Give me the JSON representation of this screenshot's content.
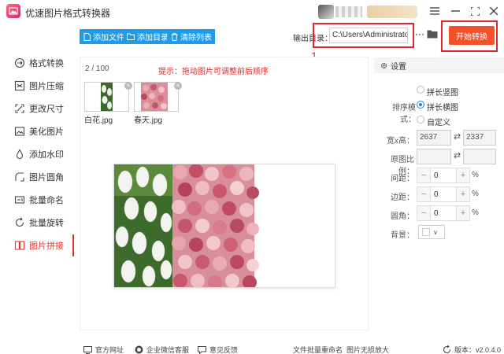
{
  "app": {
    "title": "优速图片格式转换器"
  },
  "sidebar": {
    "items": [
      {
        "label": "格式转换",
        "icon": "format-convert-icon"
      },
      {
        "label": "图片压缩",
        "icon": "compress-icon"
      },
      {
        "label": "更改尺寸",
        "icon": "resize-icon"
      },
      {
        "label": "美化图片",
        "icon": "beautify-icon"
      },
      {
        "label": "添加水印",
        "icon": "watermark-icon"
      },
      {
        "label": "图片圆角",
        "icon": "round-corner-icon"
      },
      {
        "label": "批量命名",
        "icon": "rename-icon"
      },
      {
        "label": "批量旋转",
        "icon": "rotate-icon"
      },
      {
        "label": "图片拼接",
        "icon": "stitch-icon",
        "active": true
      }
    ]
  },
  "toolbar": {
    "add_file": "添加文件",
    "add_dir": "添加目录",
    "clear_list": "清除列表",
    "output_label": "输出目录：",
    "output_path": "C:\\Users\\Administrator\\",
    "start_label": "开始转换"
  },
  "annotations": {
    "box1": "1",
    "box2": "2"
  },
  "main": {
    "page_count": "2 / 100",
    "hint": "提示：拖动图片可调整前后顺序",
    "thumbnails": [
      {
        "label": "白花.jpg"
      },
      {
        "label": "春天.jpg"
      }
    ]
  },
  "settings": {
    "title": "设置",
    "mode_label": "排序模式：",
    "mode_options": [
      "拼长竖图",
      "拼长横图",
      "自定义"
    ],
    "mode_selected": "拼长横图",
    "size_label": "宽x高：",
    "width": "2637",
    "height": "2337",
    "ratio_label": "原图比例：",
    "spacing_label": "间距：",
    "spacing_value": "0",
    "margin_label": "边距：",
    "margin_value": "0",
    "radius_label": "圆角：",
    "radius_value": "0",
    "percent": "%",
    "bg_label": "背景：",
    "bg_color": "#ffffff"
  },
  "statusbar": {
    "website": "官方网址",
    "wechat": "企业微信客服",
    "feedback": "意见反馈",
    "batch_rename": "文件批量重命名",
    "enlarge": "图片无损放大",
    "version": "版本：v2.0.4.0"
  }
}
